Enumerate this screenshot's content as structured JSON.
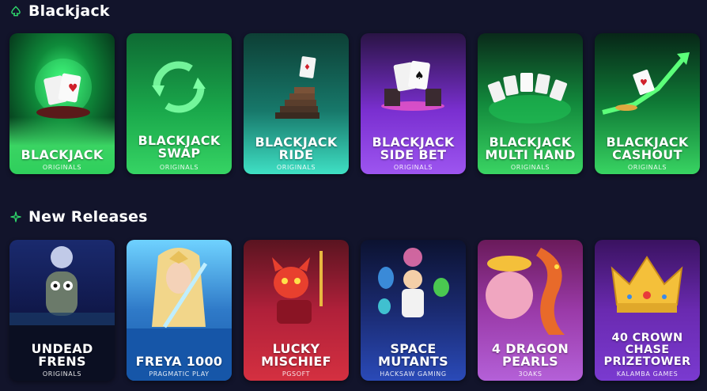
{
  "sections": {
    "blackjack": {
      "title": "Blackjack",
      "icon": "spade-icon",
      "accent": "#2fd66b",
      "games": [
        {
          "name": "BLACKJACK",
          "provider": "ORIGINALS"
        },
        {
          "name": "BLACKJACK SWAP",
          "provider": "ORIGINALS"
        },
        {
          "name": "BLACKJACK RIDE",
          "provider": "ORIGINALS"
        },
        {
          "name": "BLACKJACK SIDE BET",
          "provider": "ORIGINALS"
        },
        {
          "name": "BLACKJACK MULTI HAND",
          "provider": "ORIGINALS"
        },
        {
          "name": "BLACKJACK CASHOUT",
          "provider": "ORIGINALS"
        }
      ]
    },
    "new_releases": {
      "title": "New Releases",
      "icon": "sparkle-icon",
      "accent": "#2fd66b",
      "games": [
        {
          "name": "UNDEAD FRENS",
          "provider": "ORIGINALS"
        },
        {
          "name": "FREYA 1000",
          "provider": "PRAGMATIC PLAY"
        },
        {
          "name": "LUCKY MISCHIEF",
          "provider": "PGSOFT"
        },
        {
          "name": "SPACE MUTANTS",
          "provider": "HACKSAW GAMING"
        },
        {
          "name": "4 DRAGON PEARLS",
          "provider": "3OAKS"
        },
        {
          "name": "40 CROWN CHASE PRIZETOWER",
          "provider": "KALAMBA GAMES"
        }
      ]
    }
  }
}
